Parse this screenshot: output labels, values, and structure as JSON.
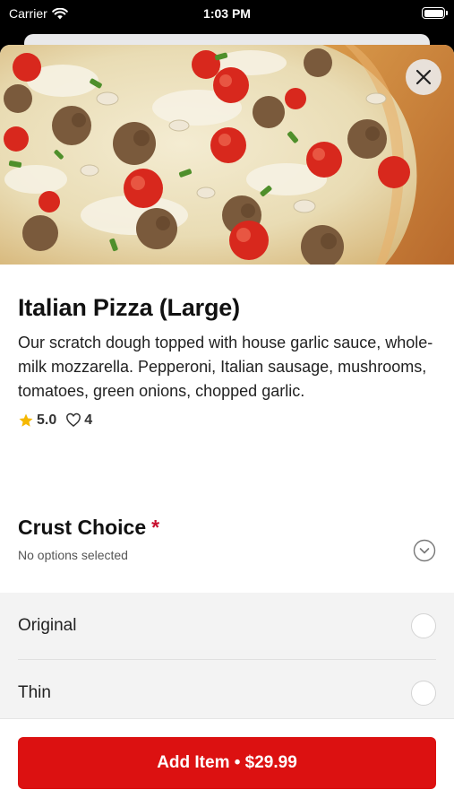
{
  "status_bar": {
    "carrier": "Carrier",
    "time": "1:03 PM"
  },
  "item": {
    "title": "Italian Pizza (Large)",
    "description": "Our scratch dough topped with house garlic sauce, whole-milk mozzarella. Pepperoni, Italian sausage, mushrooms, tomatoes, green onions, chopped garlic.",
    "rating": "5.0",
    "likes": "4"
  },
  "section": {
    "title": "Crust Choice",
    "required_mark": "*",
    "subtitle": "No options selected",
    "options": [
      {
        "label": "Original"
      },
      {
        "label": "Thin"
      }
    ]
  },
  "footer": {
    "button_label": "Add Item • $29.99"
  },
  "icons": {
    "close": "close-icon",
    "star": "star-icon",
    "heart": "heart-icon",
    "chevron": "chevron-down-icon",
    "wifi": "wifi-icon",
    "battery": "battery-icon"
  },
  "colors": {
    "accent": "#dc1111",
    "required": "#c8102e",
    "star": "#f5b800"
  }
}
